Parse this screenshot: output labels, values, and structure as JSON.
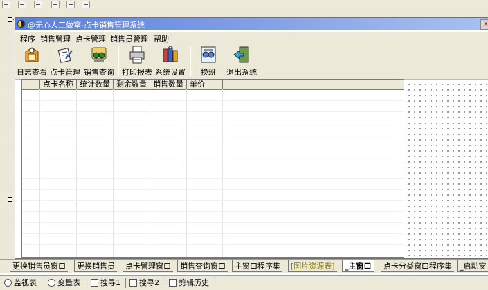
{
  "app": {
    "title": "@无心人工做室-点卡销售管理系统",
    "close_label": "x"
  },
  "menu": [
    "程序",
    "销售管理",
    "点卡管理",
    "销售员管理",
    "帮助"
  ],
  "toolbar": [
    {
      "label": "日志查看",
      "icon": "log-view-icon"
    },
    {
      "label": "点卡管理",
      "icon": "card-manage-icon"
    },
    {
      "label": "销售查询",
      "icon": "sales-query-icon"
    },
    {
      "label": "打印报表",
      "icon": "printer-icon"
    },
    {
      "label": "系统设置",
      "icon": "settings-icon"
    },
    {
      "label": "换班",
      "icon": "shift-change-icon"
    },
    {
      "label": "退出系统",
      "icon": "exit-icon"
    }
  ],
  "grid": {
    "columns": [
      "",
      "点卡名称",
      "统计数量",
      "剩余数量",
      "销售数量",
      "单价"
    ]
  },
  "designer_tabs": [
    {
      "label": "更换销售员窗口",
      "active": false
    },
    {
      "label": "更换销售员",
      "active": false
    },
    {
      "label": "点卡管理窗口",
      "active": false
    },
    {
      "label": "销售查询窗口",
      "active": false
    },
    {
      "label": "主窗口程序集",
      "active": false
    },
    {
      "label": "[图片资源表]",
      "active": false
    },
    {
      "label": "_主窗口",
      "active": true
    },
    {
      "label": "点卡分类窗口程序集",
      "active": false
    },
    {
      "label": "_启动窗",
      "active": false
    }
  ],
  "bottom_tabs": [
    {
      "label": "监视表",
      "icon": "magnifier-icon"
    },
    {
      "label": "变量表",
      "icon": "glasses-icon"
    },
    {
      "label": "搜寻1",
      "icon": "search-window-icon"
    },
    {
      "label": "搜寻2",
      "icon": "search-window-icon"
    },
    {
      "label": "剪辑历史",
      "icon": "clipboard-icon"
    }
  ],
  "colors": {
    "titlebar_start": "#5b7edc",
    "titlebar_end": "#a9c0f0",
    "chrome": "#ece9d8"
  }
}
